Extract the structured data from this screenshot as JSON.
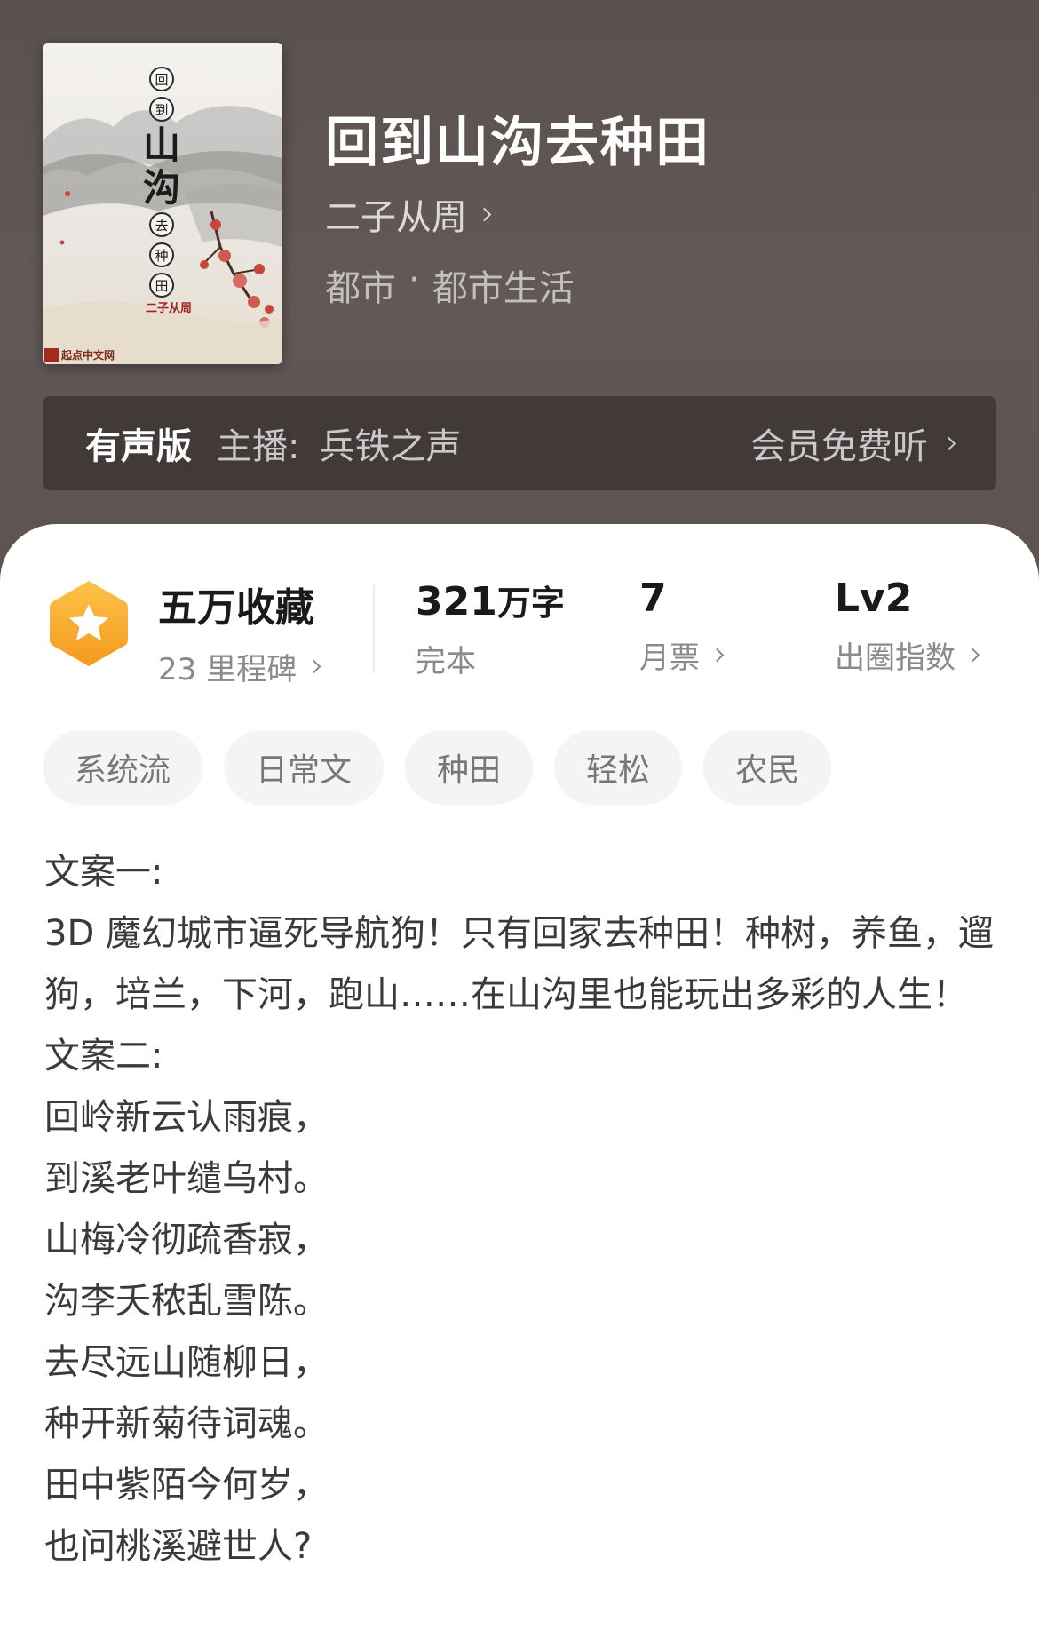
{
  "book": {
    "title": "回到山沟去种田",
    "author": "二子从周",
    "genre": "都市",
    "genre_separator": "·",
    "subgenre": "都市生活",
    "cover": {
      "title_small_top": [
        "回",
        "到"
      ],
      "title_big": [
        "山",
        "沟"
      ],
      "title_small_bottom": [
        "去",
        "种",
        "田"
      ],
      "author": "二子从周",
      "publisher": "起点中文网"
    }
  },
  "audio": {
    "label": "有声版",
    "host_label": "主播:",
    "host_name": "兵铁之声",
    "member_label": "会员免费听"
  },
  "stats": {
    "collections": "五万收藏",
    "milestones": "23 里程碑",
    "word_count_number": "321",
    "word_count_unit": "万字",
    "status": "完本",
    "monthly_votes": "7",
    "monthly_votes_label": "月票",
    "level": "Lv2",
    "level_label": "出圈指数"
  },
  "tags": [
    "系统流",
    "日常文",
    "种田",
    "轻松",
    "农民"
  ],
  "description": [
    "文案一:",
    "3D 魔幻城市逼死导航狗！只有回家去种田！种树，养鱼，遛狗，培兰，下河，跑山……在山沟里也能玩出多彩的人生！",
    "文案二:",
    "回岭新云认雨痕，",
    "到溪老叶缱乌村。",
    "山梅冷彻疏香寂，",
    "沟李夭秾乱雪陈。",
    "去尽远山随柳日，",
    "种开新菊待词魂。",
    "田中紫陌今何岁，",
    "也问桃溪避世人?"
  ],
  "colors": {
    "hero_bg": "#5e5553",
    "badge_orange": "#f5a623",
    "tag_bg": "#f4f4f4"
  }
}
